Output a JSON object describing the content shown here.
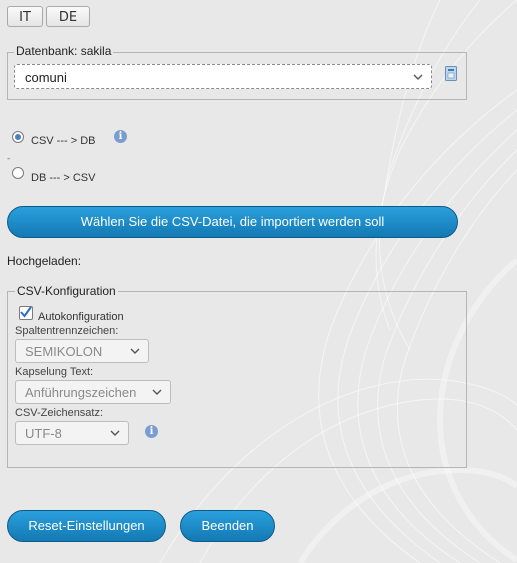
{
  "languages": [
    "IT",
    "DE"
  ],
  "database": {
    "legend": "Datenbank: sakila",
    "selected": "comuni",
    "delete_icon": "trash-icon"
  },
  "direction": {
    "options": [
      {
        "label": "CSV --- > DB",
        "selected": true
      },
      {
        "label": "DB --- > CSV",
        "selected": false
      }
    ],
    "info_icon": "info-icon"
  },
  "choose_file_button": "Wählen Sie die CSV-Datei, die importiert werden soll",
  "uploaded_label": "Hochgeladen:",
  "csv_config": {
    "legend": "CSV-Konfiguration",
    "autoconfig_label": "Autokonfiguration",
    "autoconfig_checked": true,
    "separator_label": "Spaltentrennzeichen:",
    "separator_value": "SEMIKOLON",
    "enclosure_label": "Kapselung Text:",
    "enclosure_value": "Anführungszeichen",
    "charset_label": "CSV-Zeichensatz:",
    "charset_value": "UTF-8"
  },
  "buttons": {
    "reset": "Reset-Einstellungen",
    "finish": "Beenden"
  },
  "colors": {
    "button_blue": "#1a8bc8",
    "background": "#e9e9e9"
  }
}
